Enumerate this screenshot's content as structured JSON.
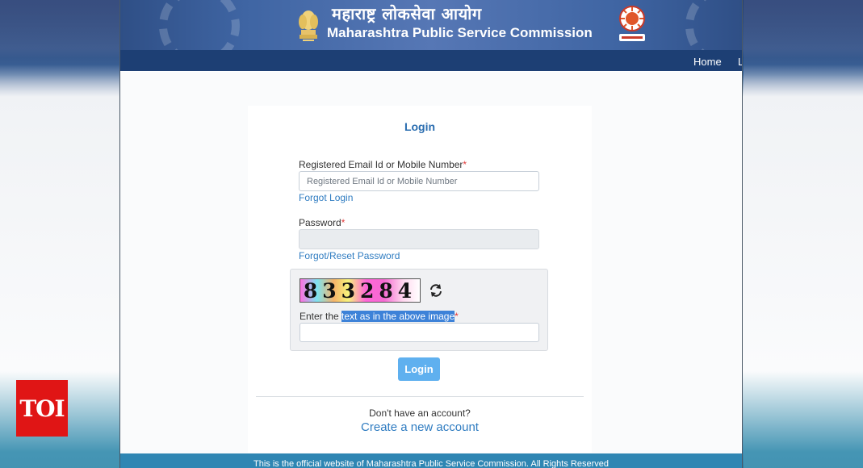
{
  "header": {
    "title_hi": "महाराष्ट्र लोकसेवा आयोग",
    "title_en": "Maharashtra Public Service Commission"
  },
  "nav": {
    "home": "Home",
    "more": "L"
  },
  "login": {
    "title": "Login",
    "email_label": "Registered Email Id or Mobile Number",
    "email_placeholder": "Registered Email Id or Mobile Number",
    "required_mark": "*",
    "forgot_login": "Forgot Login",
    "password_label": "Password",
    "forgot_password": "Forgot/Reset Password",
    "captcha_text": "833284",
    "captcha_label_prefix": "Enter the ",
    "captcha_label_highlight": "text as in the above image",
    "submit": "Login",
    "no_account": "Don't have an account?",
    "create_account": "Create a new account"
  },
  "footer": {
    "text": "This is the official website of Maharashtra Public Service Commission. All Rights Reserved"
  },
  "watermark": {
    "text": "TOI"
  },
  "colors": {
    "navbar": "#1d3f74",
    "link": "#2f7cc1",
    "button": "#5fb0ef",
    "required": "#e23b3b",
    "footer": "#2f86b3",
    "toi": "#e01515"
  }
}
